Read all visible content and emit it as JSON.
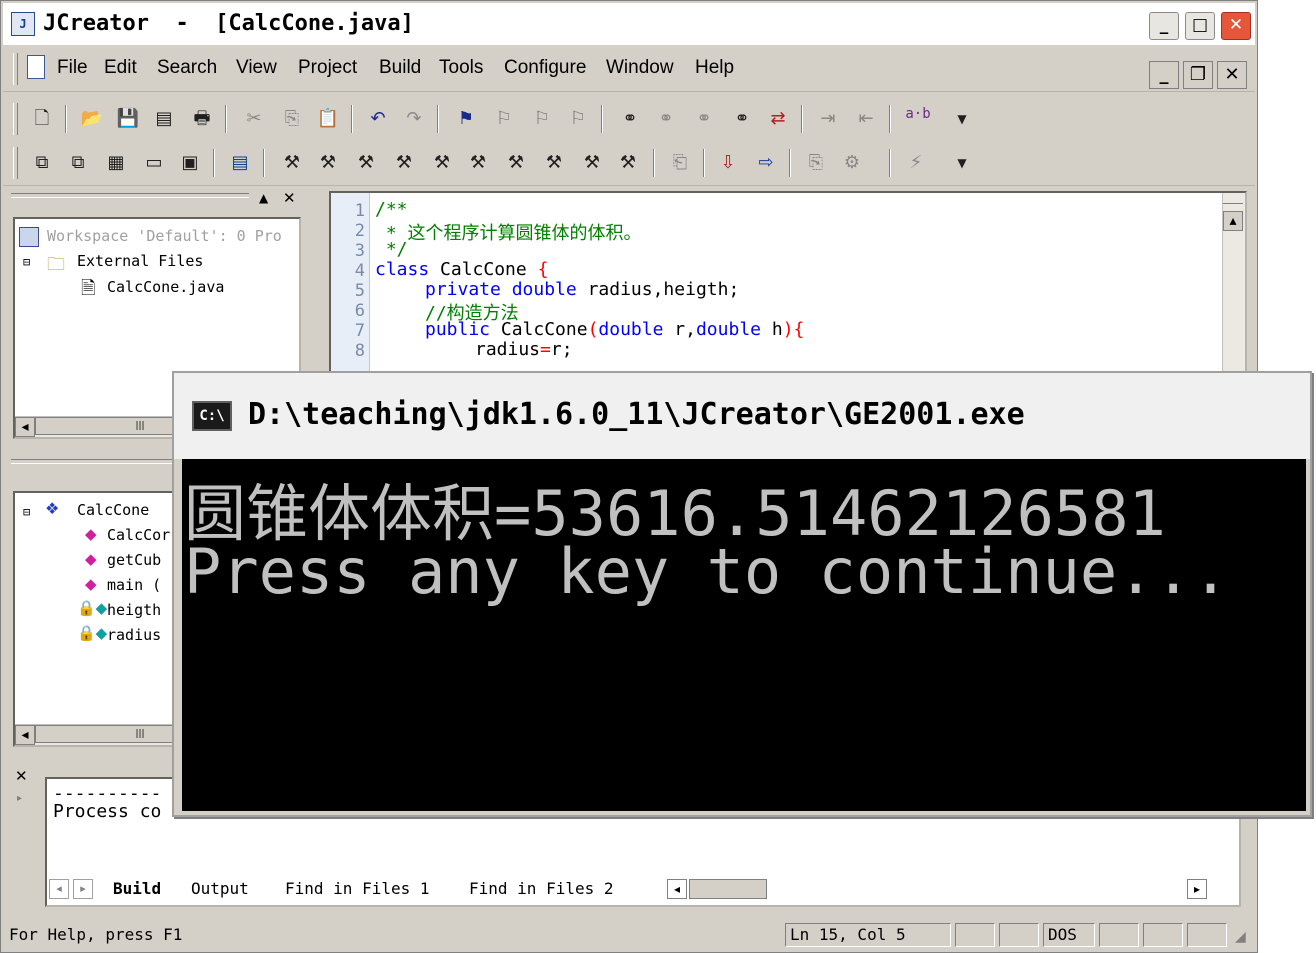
{
  "window": {
    "title": "JCreator  -  [CalcCone.java]",
    "controls": {
      "minimize": "_",
      "maximize": "□",
      "close": "✕"
    }
  },
  "menu": {
    "items": [
      "File",
      "Edit",
      "Search",
      "View",
      "Project",
      "Build",
      "Tools",
      "Configure",
      "Window",
      "Help"
    ],
    "mdi_controls": {
      "minimize": "_",
      "restore": "❐",
      "close": "✕"
    }
  },
  "toolbar1": {
    "icons": [
      "new-file-icon",
      "open-icon",
      "save-icon",
      "save-all-icon",
      "print-icon",
      "cut-icon",
      "copy-icon",
      "paste-icon",
      "undo-icon",
      "redo-icon",
      "bookmark-toggle-icon",
      "bookmark-next-icon",
      "bookmark-prev-icon",
      "bookmark-clear-icon",
      "find-icon",
      "find-next-icon",
      "find-prev-icon",
      "find-in-files-icon",
      "replace-icon",
      "indent-icon",
      "unindent-icon"
    ],
    "ab_label": "a·b"
  },
  "toolbar2": {
    "icons": [
      "cascade-icon",
      "tile-icon",
      "arrange-icon",
      "split-icon",
      "fullscreen-icon",
      "workspace-icon",
      "tool-1-icon",
      "tool-2-icon",
      "tool-3-icon",
      "tool-4-icon",
      "tool-5-icon",
      "tool-6-icon",
      "tool-7-icon",
      "tool-8-icon",
      "tool-9-icon",
      "tool-10-icon",
      "compile-icon",
      "execute-icon",
      "debug-icon",
      "build-icon",
      "plugin-icon",
      "macro-icon"
    ]
  },
  "workspace": {
    "root": "Workspace 'Default': 0 Pro",
    "folder": "External Files",
    "file": "CalcCone.java"
  },
  "classview": {
    "class_name": "CalcCone",
    "members": [
      "CalcCor",
      "getCub",
      "main (",
      "heigth",
      "radius"
    ]
  },
  "editor": {
    "line_numbers": [
      "1",
      "2",
      "3",
      "4",
      "5",
      "6",
      "7",
      "8"
    ],
    "lines": {
      "l1": "/**",
      "l2": " * 这个程序计算圆锥体的体积。",
      "l3": " */",
      "l4_kw": "class",
      "l4_name": " CalcCone ",
      "l4_brace": "{",
      "l5_kw1": "private",
      "l5_kw2": "double",
      "l5_rest": " radius,heigth;",
      "l6": "//构造方法",
      "l7_kw": "public",
      "l7_name": " CalcCone",
      "l7_p1": "(",
      "l7_kw2": "double",
      "l7_r": " r,",
      "l7_kw3": "double",
      "l7_h": " h",
      "l7_p2": "){",
      "l8_a": "radius",
      "l8_eq": "=",
      "l8_b": "r;"
    }
  },
  "output": {
    "line1": "----------",
    "line2": "Process co",
    "tabs": [
      "Build",
      "Output",
      "Find in Files 1",
      "Find in Files 2"
    ]
  },
  "statusbar": {
    "help": "For Help, press F1",
    "position": "Ln 15, Col 5",
    "mode": "DOS"
  },
  "console": {
    "title": "D:\\teaching\\jdk1.6.0_11\\JCreator\\GE2001.exe",
    "icon_label": "C:\\",
    "line1": "圆锥体体积=53616.51462126581",
    "line2": "Press any key to continue..."
  }
}
